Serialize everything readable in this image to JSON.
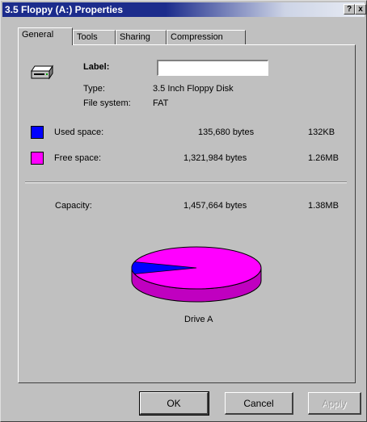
{
  "window": {
    "title": "3.5 Floppy (A:) Properties"
  },
  "title_buttons": {
    "help": "?",
    "close": "x"
  },
  "tabs": [
    {
      "label": "General",
      "active": true
    },
    {
      "label": "Tools",
      "active": false
    },
    {
      "label": "Sharing",
      "active": false
    },
    {
      "label": "Compression",
      "active": false
    }
  ],
  "general": {
    "label_caption": "Label:",
    "label_value": "",
    "type_caption": "Type:",
    "type_value": "3.5 Inch Floppy Disk",
    "fs_caption": "File system:",
    "fs_value": "FAT",
    "icon": "floppy-drive-icon"
  },
  "space": {
    "used": {
      "caption": "Used space:",
      "bytes": "135,680 bytes",
      "short": "132KB",
      "color": "#0000ff"
    },
    "free": {
      "caption": "Free space:",
      "bytes": "1,321,984 bytes",
      "short": "1.26MB",
      "color": "#ff00ff"
    },
    "capacity": {
      "caption": "Capacity:",
      "bytes": "1,457,664 bytes",
      "short": "1.38MB"
    }
  },
  "chart": {
    "caption": "Drive A",
    "used_fraction": 0.093,
    "used_color": "#0000ff",
    "free_color": "#ff00ff"
  },
  "buttons": {
    "ok": "OK",
    "cancel": "Cancel",
    "apply": "Apply"
  }
}
